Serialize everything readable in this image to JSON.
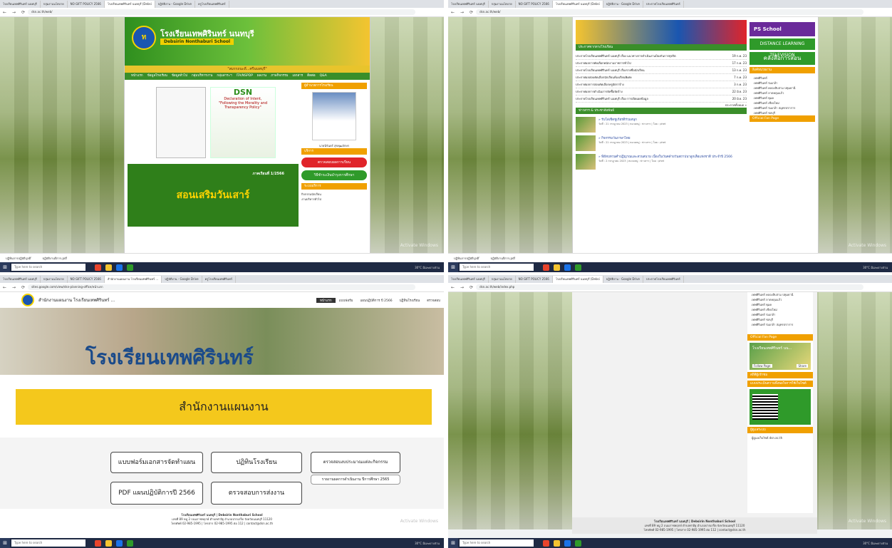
{
  "shared": {
    "tabs": [
      "โรงเรียนเทพศิรินทร์ นนทบุรี",
      "กลุ่มงานนโยบาย",
      "NO GIFT POLICY 2566",
      "โรงเรียนเทพศิรินทร์ นนทบุรี (Debsi",
      "ปฏิบัติงาน - Google Drive",
      "ครูโรงเรียนเทพศิรินทร์",
      "ประกาศโรงเรียนเทพศิรินทร์"
    ],
    "taskbar_search": "Type here to search",
    "clock": "30°C มีเมฆบางส่วน",
    "activate": "Activate Windows",
    "downloads": [
      "ปฏิทินการปฏิบัติ.pdf",
      "ปฏิบัติงานปีการ.pdf"
    ]
  },
  "q1": {
    "url": "dsn.ac.th/web/",
    "school_th": "โรงเรียนเทพศิรินทร์ นนทบุรี",
    "school_en": "Debsirin Nonthaburi School",
    "slogan": "\"สมรรถนะดี...ศรีนนทบุรี\"",
    "menu": [
      "หน้าแรก",
      "ข้อมูลโรงเรียน",
      "ข้อมูลทั่วไป",
      "กลุ่มบริหารงาน",
      "กลุ่มสาระฯ",
      "ITA/NSPDP",
      "ผลงาน",
      "ภาพกิจกรรม",
      "เอกสาร",
      "ติดต่อ",
      "Q&A"
    ],
    "dsn_title": "DSN",
    "dsn_sub": "Declaration of Intent,",
    "dsn_sub2": "\"Following the Morality and Transparency Policy\"",
    "promo_text": "สอนเสริมวันเสาร์",
    "promo_sub": "ภาคเรียนที่ 1/2566",
    "side_hdr1": "ผู้อำนวยการโรงเรียน",
    "director_cap": "นายนิรันดร์ สุขพุฒอักษร",
    "side_hdr2": "บริการ",
    "btn_red": "ตรวจสอบผลการเรียน",
    "btn_green": "วิธีชำระเงินบำรุงการศึกษา",
    "side_hdr3": "ระบบบริการ",
    "side_links": [
      "กิจกรรมนักเรียน",
      "งานบริหารทั่วไป"
    ]
  },
  "q2": {
    "url": "dsn.ac.th/web/",
    "news_hdr": "ประกาศจากทางโรงเรียน",
    "news": [
      {
        "t": "ประกาศโรงเรียนเทพศิรินทร์ นนทบุรี เรื่อง แนวทางการดำเนินงานป้องกันการทุจริต",
        "d": "19 ก.ค. 23"
      },
      {
        "t": "ประกาศผลการคัดเลือกพนักงานราชการทั่วไป",
        "d": "17 ก.ค. 23"
      },
      {
        "t": "ประกาศโรงเรียนเทพศิรินทร์ นนทบุรี เรื่องรายชื่อนักเรียน",
        "d": "13 ก.ค. 23"
      },
      {
        "t": "ประกาศผลสอบคัดเลือกนักเรียนห้องเรียนพิเศษ",
        "d": "7 ก.ค. 23"
      },
      {
        "t": "ประกาศผลการสอบคัดเลือกครูอัตราจ้าง",
        "d": "3 ก.ค. 23"
      },
      {
        "t": "ประกาศผลการดำเนินการจัดซื้อจัดจ้าง",
        "d": "22 มิ.ย. 23"
      },
      {
        "t": "ประกาศโรงเรียนเทพศิรินทร์ นนทบุรี เรื่อง การเปิดเผยข้อมูล",
        "d": "20 มิ.ย. 23"
      }
    ],
    "more": "ประกาศทั้งหมด »",
    "act_hdr": "ข่าวสาร & ประชาสัมพันธ์",
    "acts": [
      {
        "t": "» รับโล่เชิดชูเกียรติร่วมสนุก",
        "d": "วันที่ : 21 กรกฎาคม 2023 | หมวดหมู่ : ข่าวสาร | โดย : phet"
      },
      {
        "t": "» กิจกรรมวันภาษาไทย",
        "d": "วันที่ : 21 กรกฎาคม 2023 | หมวดหมู่ : ข่าวสาร | โดย : phet"
      },
      {
        "t": "» พิธีทบทวนคำปฏิญาณและสวนสนาม เนื่องในวันคล้ายวันสถาปนาลูกเสือแห่งชาติ ประจำปี 2566",
        "d": "วันที่ : 2 กรกฎาคม 2023 | หมวดหมู่ : ข่าวสาร | โดย : phet"
      }
    ],
    "ps": "PS School",
    "dl": "DISTANCE LEARNING TELEVISION",
    "kl": "คลังสื่อการสอน",
    "side_hdr": "ลิงค์หน่วยงาน",
    "links": [
      "เทพศิรินทร์",
      "เทพศิรินทร์ ร่มเกล้า",
      "เทพศิรินทร์ คลองสิบสาม ปทุมธานี",
      "เทพศิรินทร์ ลาดหลุมแก้ว",
      "เทพศิรินทร์ พุแค",
      "เทพศิรินทร์ เชียงใหม่",
      "เทพศิรินทร์ ร่มเกล้า สมุทรปราการ",
      "เทพศิรินทร์ ชลบุรี"
    ],
    "fb_hdr": "Official Fan Page"
  },
  "q3": {
    "url": "sites.google.com/view/dsn-planning-office/หน้าแรก",
    "site_title": "สำนักงานแผนงาน โรงเรียนเทพศิรินทร์ ...",
    "nav": [
      "หน้าแรก",
      "แบบฟอร์ม",
      "แผนปฏิบัติการ ปี 2566",
      "ปฏิทินโรงเรียน",
      "ตรวจสอบ"
    ],
    "banner_word": "โรงเรียนเทพศิรินทร์",
    "heading": "สำนักงานแผนงาน",
    "btn1": "แบบฟอร์มเอกสารจัดทำแผน",
    "btn2": "ปฏิทินโรงเรียน",
    "btn3": "ตรวจสอบงบประมาณแต่ละกิจกรรม",
    "btn4": "PDF แผนปฏิบัติการปี 2566",
    "btn5": "ตรวจสอบการส่งงาน",
    "btn6": "รายงานผลการดำเนินงาน ปีการศึกษา 2565",
    "foot1": "โรงเรียนเทพศิรินทร์ นนทบุรี | Debsirin Nonthaburi School",
    "foot2": "เลขที่ 89 หมู่ 2 ถนนราชพฤกษ์ ตำบลท่าอิฐ อำเภอปากเกร็ด จังหวัดนนทบุรี 11120",
    "foot3": "โทรศัพท์ 02-985-1995 | โทรสาร 02-985-1995 ต่อ 112 | contact@dsn.ac.th"
  },
  "q4": {
    "url": "dsn.ac.th/web/index.php",
    "links": [
      "เทพศิรินทร์ คลองสิบสาม ปทุมธานี",
      "เทพศิรินทร์ ลาดหลุมแก้ว",
      "เทพศิรินทร์ พุแค",
      "เทพศิรินทร์ เชียงใหม่",
      "เทพศิรินทร์ ร่มเกล้า",
      "เทพศิรินทร์ ชลบุรี",
      "เทพศิรินทร์ ร่มเกล้า สมุทรปราการ"
    ],
    "fb_hdr": "Official Fan Page",
    "fb_name": "โรงเรียนเทพศิรินทร์ นน...",
    "fb_follow": "Follow Page",
    "fb_share": "Share",
    "stat_hdr": "สถิติผู้เข้าชม",
    "qr_hdr": "แบบประเมินความพึงพอใจการใช้เว็บไซต์",
    "admin_hdr": "ผู้ดูแลระบบ",
    "admin_text": "ผู้ดูแลเว็บไซต์ dsn.ac.th",
    "foot1": "โรงเรียนเทพศิรินทร์ นนทบุรี | Debsirin Nonthaburi School",
    "foot2": "เลขที่ 89 หมู่ 2 ถนนราชพฤกษ์ ตำบลท่าอิฐ อำเภอปากเกร็ด จังหวัดนนทบุรี 11120",
    "foot3": "โทรศัพท์ 02-985-1995 | โทรสาร 02-985-1995 ต่อ 112 | contact@dsn.ac.th"
  }
}
